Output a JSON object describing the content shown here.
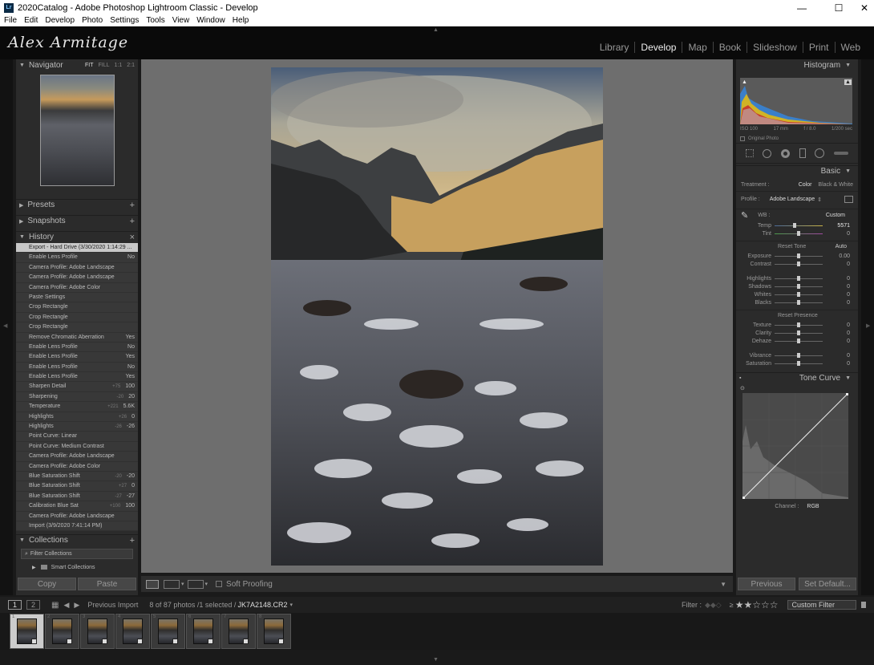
{
  "window": {
    "title": "2020Catalog - Adobe Photoshop Lightroom Classic - Develop",
    "app_badge": "Lr",
    "min": "—",
    "max": "☐",
    "close": "✕"
  },
  "menu": [
    "File",
    "Edit",
    "Develop",
    "Photo",
    "Settings",
    "Tools",
    "View",
    "Window",
    "Help"
  ],
  "identity_plate": "Alex Armitage",
  "modules": [
    "Library",
    "Develop",
    "Map",
    "Book",
    "Slideshow",
    "Print",
    "Web"
  ],
  "navigator": {
    "title": "Navigator",
    "zoom": [
      "FIT",
      "FILL",
      "1:1",
      "2:1"
    ]
  },
  "presets": {
    "title": "Presets"
  },
  "snapshots": {
    "title": "Snapshots"
  },
  "history": {
    "title": "History",
    "close": "×",
    "items": [
      {
        "label": "Export - Hard Drive (3/30/2020 1:14:29 ...",
        "a": "",
        "b": ""
      },
      {
        "label": "Enable Lens Profile",
        "a": "",
        "b": "No"
      },
      {
        "label": "Camera Profile: Adobe Landscape",
        "a": "",
        "b": ""
      },
      {
        "label": "Camera Profile: Adobe Landscape",
        "a": "",
        "b": ""
      },
      {
        "label": "Camera Profile: Adobe Color",
        "a": "",
        "b": ""
      },
      {
        "label": "Paste Settings",
        "a": "",
        "b": ""
      },
      {
        "label": "Crop Rectangle",
        "a": "",
        "b": ""
      },
      {
        "label": "Crop Rectangle",
        "a": "",
        "b": ""
      },
      {
        "label": "Crop Rectangle",
        "a": "",
        "b": ""
      },
      {
        "label": "Remove Chromatic Aberration",
        "a": "",
        "b": "Yes"
      },
      {
        "label": "Enable Lens Profile",
        "a": "",
        "b": "No"
      },
      {
        "label": "Enable Lens Profile",
        "a": "",
        "b": "Yes"
      },
      {
        "label": "Enable Lens Profile",
        "a": "",
        "b": "No"
      },
      {
        "label": "Enable Lens Profile",
        "a": "",
        "b": "Yes"
      },
      {
        "label": "Sharpen Detail",
        "a": "+75",
        "b": "100"
      },
      {
        "label": "Sharpening",
        "a": "-20",
        "b": "20"
      },
      {
        "label": "Temperature",
        "a": "+221",
        "b": "5.6K"
      },
      {
        "label": "Highlights",
        "a": "+26",
        "b": "0"
      },
      {
        "label": "Highlights",
        "a": "-26",
        "b": "-26"
      },
      {
        "label": "Point Curve: Linear",
        "a": "",
        "b": ""
      },
      {
        "label": "Point Curve: Medium Contrast",
        "a": "",
        "b": ""
      },
      {
        "label": "Camera Profile: Adobe Landscape",
        "a": "",
        "b": ""
      },
      {
        "label": "Camera Profile: Adobe Color",
        "a": "",
        "b": ""
      },
      {
        "label": "Blue Saturation Shift",
        "a": "-20",
        "b": "-20"
      },
      {
        "label": "Blue Saturation Shift",
        "a": "+27",
        "b": "0"
      },
      {
        "label": "Blue Saturation Shift",
        "a": "-27",
        "b": "-27"
      },
      {
        "label": "Calibration Blue Sat",
        "a": "+100",
        "b": "100"
      },
      {
        "label": "Camera Profile: Adobe Landscape",
        "a": "",
        "b": ""
      },
      {
        "label": "Import (3/9/2020 7:41:14 PM)",
        "a": "",
        "b": ""
      }
    ]
  },
  "collections": {
    "title": "Collections",
    "filter": "Filter Collections",
    "smart": "Smart Collections"
  },
  "left_buttons": {
    "copy": "Copy",
    "paste": "Paste"
  },
  "toolbar": {
    "soft_proofing": "Soft Proofing"
  },
  "histogram": {
    "title": "Histogram",
    "iso": "ISO 100",
    "focal": "17 mm",
    "aperture": "f / 8.0",
    "shutter": "1/200 sec",
    "original": "Original Photo"
  },
  "basic": {
    "title": "Basic",
    "treatment_label": "Treatment :",
    "treatment_color": "Color",
    "treatment_bw": "Black & White",
    "profile_label": "Profile :",
    "profile_value": "Adobe Landscape",
    "wb_label": "WB :",
    "wb_value": "Custom",
    "temp": {
      "label": "Temp",
      "value": "5571",
      "pos": 0.42
    },
    "tint": {
      "label": "Tint",
      "value": "0",
      "pos": 0.5
    },
    "reset_tone": "Reset Tone",
    "auto": "Auto",
    "tone": [
      {
        "label": "Exposure",
        "value": "0.00",
        "pos": 0.5
      },
      {
        "label": "Contrast",
        "value": "0",
        "pos": 0.5
      },
      {
        "label": "Highlights",
        "value": "0",
        "pos": 0.5
      },
      {
        "label": "Shadows",
        "value": "0",
        "pos": 0.5
      },
      {
        "label": "Whites",
        "value": "0",
        "pos": 0.5
      },
      {
        "label": "Blacks",
        "value": "0",
        "pos": 0.5
      }
    ],
    "reset_presence": "Reset Presence",
    "presence": [
      {
        "label": "Texture",
        "value": "0",
        "pos": 0.5
      },
      {
        "label": "Clarity",
        "value": "0",
        "pos": 0.5
      },
      {
        "label": "Dehaze",
        "value": "0",
        "pos": 0.5
      },
      {
        "label": "Vibrance",
        "value": "0",
        "pos": 0.5
      },
      {
        "label": "Saturation",
        "value": "0",
        "pos": 0.5
      }
    ]
  },
  "tone_curve": {
    "title": "Tone Curve",
    "channel_label": "Channel :",
    "channel_value": "RGB"
  },
  "right_buttons": {
    "previous": "Previous",
    "set_default": "Set Default..."
  },
  "filmstrip_bar": {
    "screen1": "1",
    "screen2": "2",
    "source": "Previous Import",
    "count": "8 of 87 photos /1 selected /",
    "filename": "JK7A2148.CR2",
    "filter_label": "Filter :",
    "rating_op": "≥",
    "stars": "★★☆☆☆",
    "custom_filter": "Custom Filter"
  },
  "thumbnails": [
    "1",
    "2",
    "3",
    "4",
    "5",
    "6",
    "7",
    "8"
  ]
}
